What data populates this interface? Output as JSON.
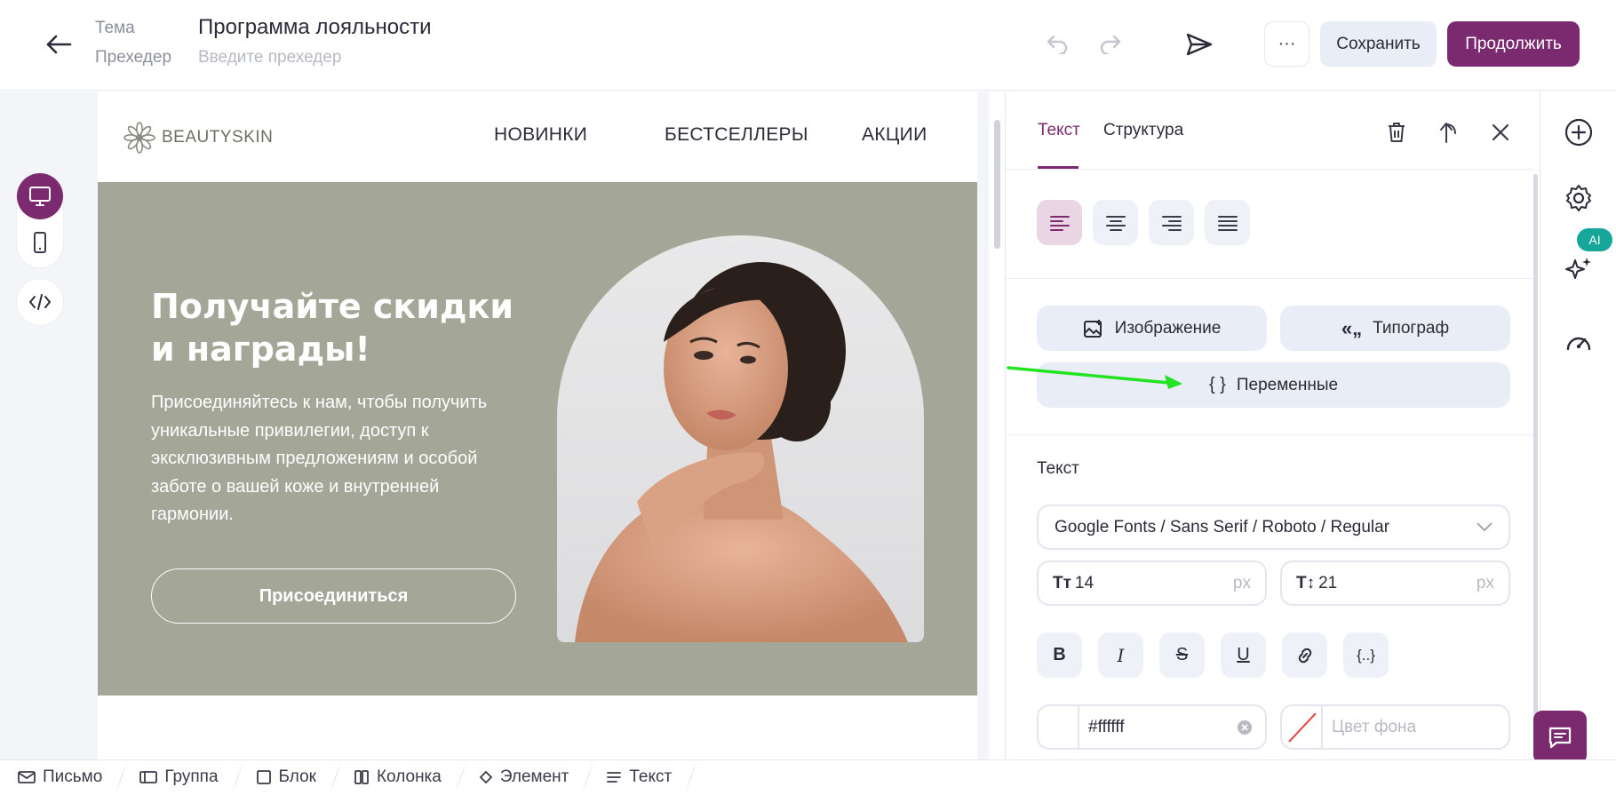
{
  "header": {
    "theme_label": "Тема",
    "theme_value": "Программа лояльности",
    "preheader_label": "Прехедер",
    "preheader_placeholder": "Введите прехедер",
    "more_label": "···",
    "save_label": "Сохранить",
    "continue_label": "Продолжить"
  },
  "email": {
    "logo_text": "BEAUTYSKIN",
    "nav": [
      "НОВИНКИ",
      "БЕСТСЕЛЛЕРЫ",
      "АКЦИИ"
    ],
    "hero": {
      "title_line1": "Получайте скидки",
      "title_line2": "и награды!",
      "text_lines": [
        "Присоединяйтесь к нам, чтобы получить",
        "уникальные привилегии, доступ к",
        "эксклюзивным предложениям и особой",
        "заботе о вашей коже и внутренней",
        "гармонии."
      ],
      "button_label": "Присоединиться",
      "background_color": "#a4a697"
    }
  },
  "panel": {
    "tabs": [
      "Текст",
      "Структура"
    ],
    "active_tab": "Текст",
    "buttons": {
      "image": "Изображение",
      "typograph": "Типограф",
      "variables": "Переменные"
    },
    "text_section_label": "Текст",
    "font_value": "Google Fonts / Sans Serif / Roboto / Regular",
    "font_size": "14",
    "line_height": "21",
    "unit": "px",
    "text_color": "#ffffff",
    "bg_color_placeholder": "Цвет фона"
  },
  "right_rail": {
    "ai_badge": "AI"
  },
  "breadcrumb": [
    "Письмо",
    "Группа",
    "Блок",
    "Колонка",
    "Элемент",
    "Текст"
  ],
  "colors": {
    "accent": "#7b2a6f",
    "annotation_arrow": "#22e422",
    "ai_badge": "#16a79a"
  }
}
